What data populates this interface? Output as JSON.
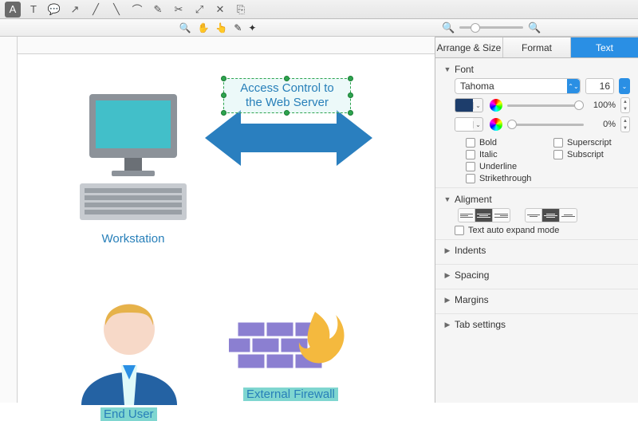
{
  "toolbar": {
    "tools": [
      "A",
      "T",
      "💬",
      "↗",
      "╱",
      "╲",
      "⌒",
      "✎",
      "✂",
      "⤢",
      "✕",
      "⎘"
    ],
    "view_tools": [
      "🔍",
      "✋",
      "👆",
      "✎",
      "✦"
    ]
  },
  "zoom": {
    "out": "−",
    "in": "＋"
  },
  "canvas": {
    "textbox": {
      "line1": "Access Control to",
      "line2": "the Web Server"
    },
    "workstation_label": "Workstation",
    "firewall_label": "External Firewall",
    "enduser_label": "End User"
  },
  "panel": {
    "tabs": {
      "arrange": "Arrange & Size",
      "format": "Format",
      "text": "Text"
    },
    "font": {
      "heading": "Font",
      "family": "Tahoma",
      "size": "16",
      "color1": "#1d3d6b",
      "opacity1": "100%",
      "color2": "#ffffff",
      "opacity2": "0%",
      "bold": "Bold",
      "italic": "Italic",
      "underline": "Underline",
      "strike": "Strikethrough",
      "superscript": "Superscript",
      "subscript": "Subscript"
    },
    "alignment": {
      "heading": "Aligment",
      "auto_expand": "Text auto expand mode"
    },
    "sections": {
      "indents": "Indents",
      "spacing": "Spacing",
      "margins": "Margins",
      "tabs": "Tab settings"
    }
  }
}
